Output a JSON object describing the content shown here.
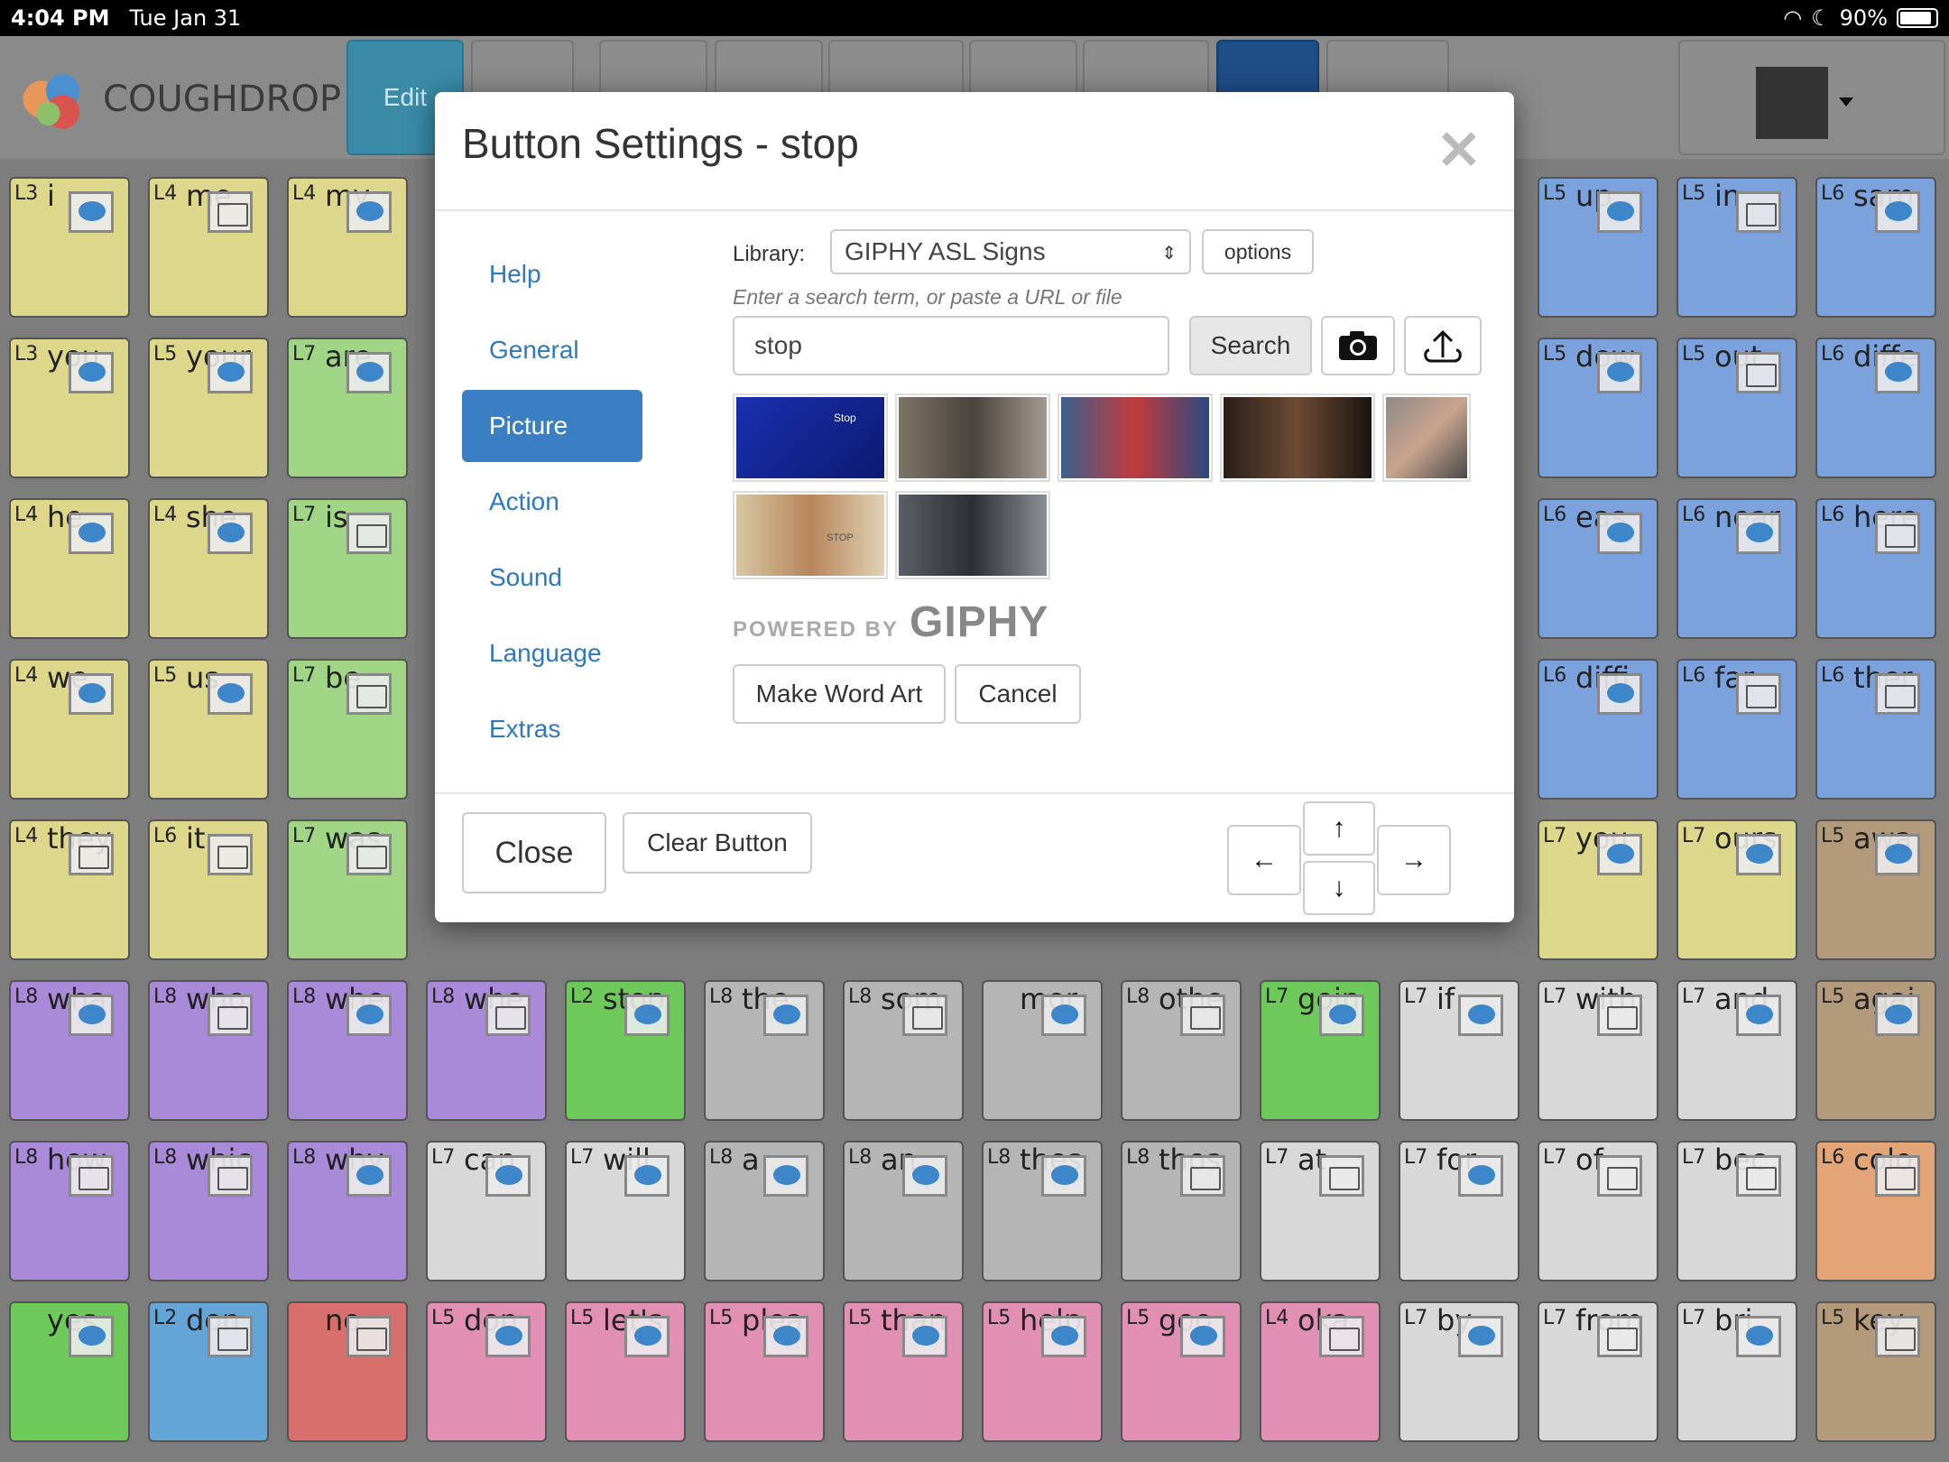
{
  "status_bar": {
    "time": "4:04 PM",
    "date": "Tue Jan 31",
    "battery": "90%",
    "battery_level": 0.9
  },
  "header": {
    "logo_text": "COUGHDROP",
    "edit_label": "Edit"
  },
  "modal": {
    "title": "Button Settings - stop",
    "nav": [
      "Help",
      "General",
      "Picture",
      "Action",
      "Sound",
      "Language",
      "Extras"
    ],
    "active_nav": "Picture",
    "library_label": "Library:",
    "library_value": "GIPHY ASL Signs",
    "options_label": "options",
    "hint": "Enter a search term, or paste a URL or file",
    "search_value": "stop",
    "search_label": "Search",
    "thumb_caption_1": "Stop",
    "thumb_caption_6": "STOP",
    "powered_by": "POWERED BY",
    "giphy": "GIPHY",
    "make_word_art": "Make Word Art",
    "cancel": "Cancel",
    "close": "Close",
    "clear_button": "Clear Button"
  },
  "colors": {
    "primary": "#3a7fc3",
    "edit": "#3a8ba8",
    "title": "#333333"
  },
  "grid": [
    [
      "L3",
      "i",
      "yellow",
      "chat"
    ],
    [
      "L4",
      "me",
      "yellow",
      "folder"
    ],
    [
      "L4",
      "my",
      "yellow",
      "chat"
    ],
    [
      "L5",
      "up",
      "blue",
      "chat"
    ],
    [
      "L5",
      "in",
      "blue",
      "folder"
    ],
    [
      "L6",
      "sam",
      "blue",
      "chat"
    ],
    [
      "L3",
      "you",
      "yellow",
      "chat"
    ],
    [
      "L5",
      "your",
      "yellow",
      "chat"
    ],
    [
      "L7",
      "are",
      "green",
      "chat"
    ],
    [
      "L5",
      "dow",
      "blue",
      "chat"
    ],
    [
      "L5",
      "out",
      "blue",
      "folder"
    ],
    [
      "L6",
      "diffe",
      "blue",
      "chat"
    ],
    [
      "L4",
      "he",
      "yellow",
      "chat"
    ],
    [
      "L4",
      "she",
      "yellow",
      "chat"
    ],
    [
      "L7",
      "is",
      "green",
      "folder"
    ],
    [
      "L6",
      "eas",
      "blue",
      "chat"
    ],
    [
      "L6",
      "near",
      "blue",
      "chat"
    ],
    [
      "L6",
      "here",
      "blue",
      "folder"
    ],
    [
      "L4",
      "we",
      "yellow",
      "chat"
    ],
    [
      "L5",
      "us",
      "yellow",
      "chat"
    ],
    [
      "L7",
      "be",
      "green",
      "folder"
    ],
    [
      "L6",
      "diffi",
      "blue",
      "chat"
    ],
    [
      "L6",
      "far",
      "blue",
      "folder"
    ],
    [
      "L6",
      "ther",
      "blue",
      "folder"
    ],
    [
      "L4",
      "they",
      "yellow",
      "folder"
    ],
    [
      "L6",
      "it",
      "yellow",
      "folder"
    ],
    [
      "L7",
      "was",
      "green",
      "folder"
    ],
    [
      "L7",
      "you",
      "yellow",
      "chat"
    ],
    [
      "L7",
      "ours",
      "yellow",
      "chat"
    ],
    [
      "L5",
      "awa",
      "brown",
      "chat"
    ],
    [
      "L8",
      "wha",
      "purple",
      "chat"
    ],
    [
      "L8",
      "who",
      "purple",
      "folder"
    ],
    [
      "L8",
      "whe",
      "purple",
      "chat"
    ],
    [
      "L8",
      "whe",
      "purple",
      "folder"
    ],
    [
      "L2",
      "stop",
      "lgreen",
      "chat"
    ],
    [
      "L8",
      "the",
      "gray",
      "chat"
    ],
    [
      "L8",
      "som",
      "gray",
      "folder"
    ],
    [
      "",
      "mor",
      "gray",
      "chat"
    ],
    [
      "L8",
      "othe",
      "gray",
      "folder"
    ],
    [
      "L7",
      "goin",
      "lgreen",
      "chat"
    ],
    [
      "L7",
      "if",
      "lgray",
      "chat"
    ],
    [
      "L7",
      "with",
      "lgray",
      "folder"
    ],
    [
      "L7",
      "and",
      "lgray",
      "chat"
    ],
    [
      "L5",
      "agai",
      "brown",
      "chat"
    ],
    [
      "L8",
      "how",
      "purple",
      "folder"
    ],
    [
      "L8",
      "whic",
      "purple",
      "folder"
    ],
    [
      "L8",
      "why",
      "purple",
      "chat"
    ],
    [
      "L7",
      "can",
      "lgray",
      "chat"
    ],
    [
      "L7",
      "will",
      "lgray",
      "chat"
    ],
    [
      "L8",
      "a",
      "gray",
      "chat"
    ],
    [
      "L8",
      "an",
      "gray",
      "chat"
    ],
    [
      "L8",
      "thes",
      "gray",
      "chat"
    ],
    [
      "L8",
      "thos",
      "gray",
      "folder"
    ],
    [
      "L7",
      "at",
      "lgray",
      "folder"
    ],
    [
      "L7",
      "for",
      "lgray",
      "chat"
    ],
    [
      "L7",
      "of",
      "lgray",
      "folder"
    ],
    [
      "L7",
      "bec",
      "lgray",
      "folder"
    ],
    [
      "L6",
      "colo",
      "orange",
      "folder"
    ],
    [
      "",
      "yes",
      "lgreen",
      "chat"
    ],
    [
      "L2",
      "don",
      "lblue",
      "folder"
    ],
    [
      "",
      "no",
      "red",
      "folder"
    ],
    [
      "L5",
      "don",
      "pink",
      "chat"
    ],
    [
      "L5",
      "let's",
      "pink",
      "chat"
    ],
    [
      "L5",
      "plea",
      "pink",
      "chat"
    ],
    [
      "L5",
      "than",
      "pink",
      "chat"
    ],
    [
      "L5",
      "help",
      "pink",
      "chat"
    ],
    [
      "L5",
      "goo",
      "pink",
      "chat"
    ],
    [
      "L4",
      "oka",
      "pink",
      "folder"
    ],
    [
      "L7",
      "by",
      "lgray",
      "chat"
    ],
    [
      "L7",
      "from",
      "lgray",
      "folder"
    ],
    [
      "L7",
      "bri",
      "lgray",
      "chat"
    ],
    [
      "L5",
      "key",
      "brown",
      "folder"
    ]
  ]
}
